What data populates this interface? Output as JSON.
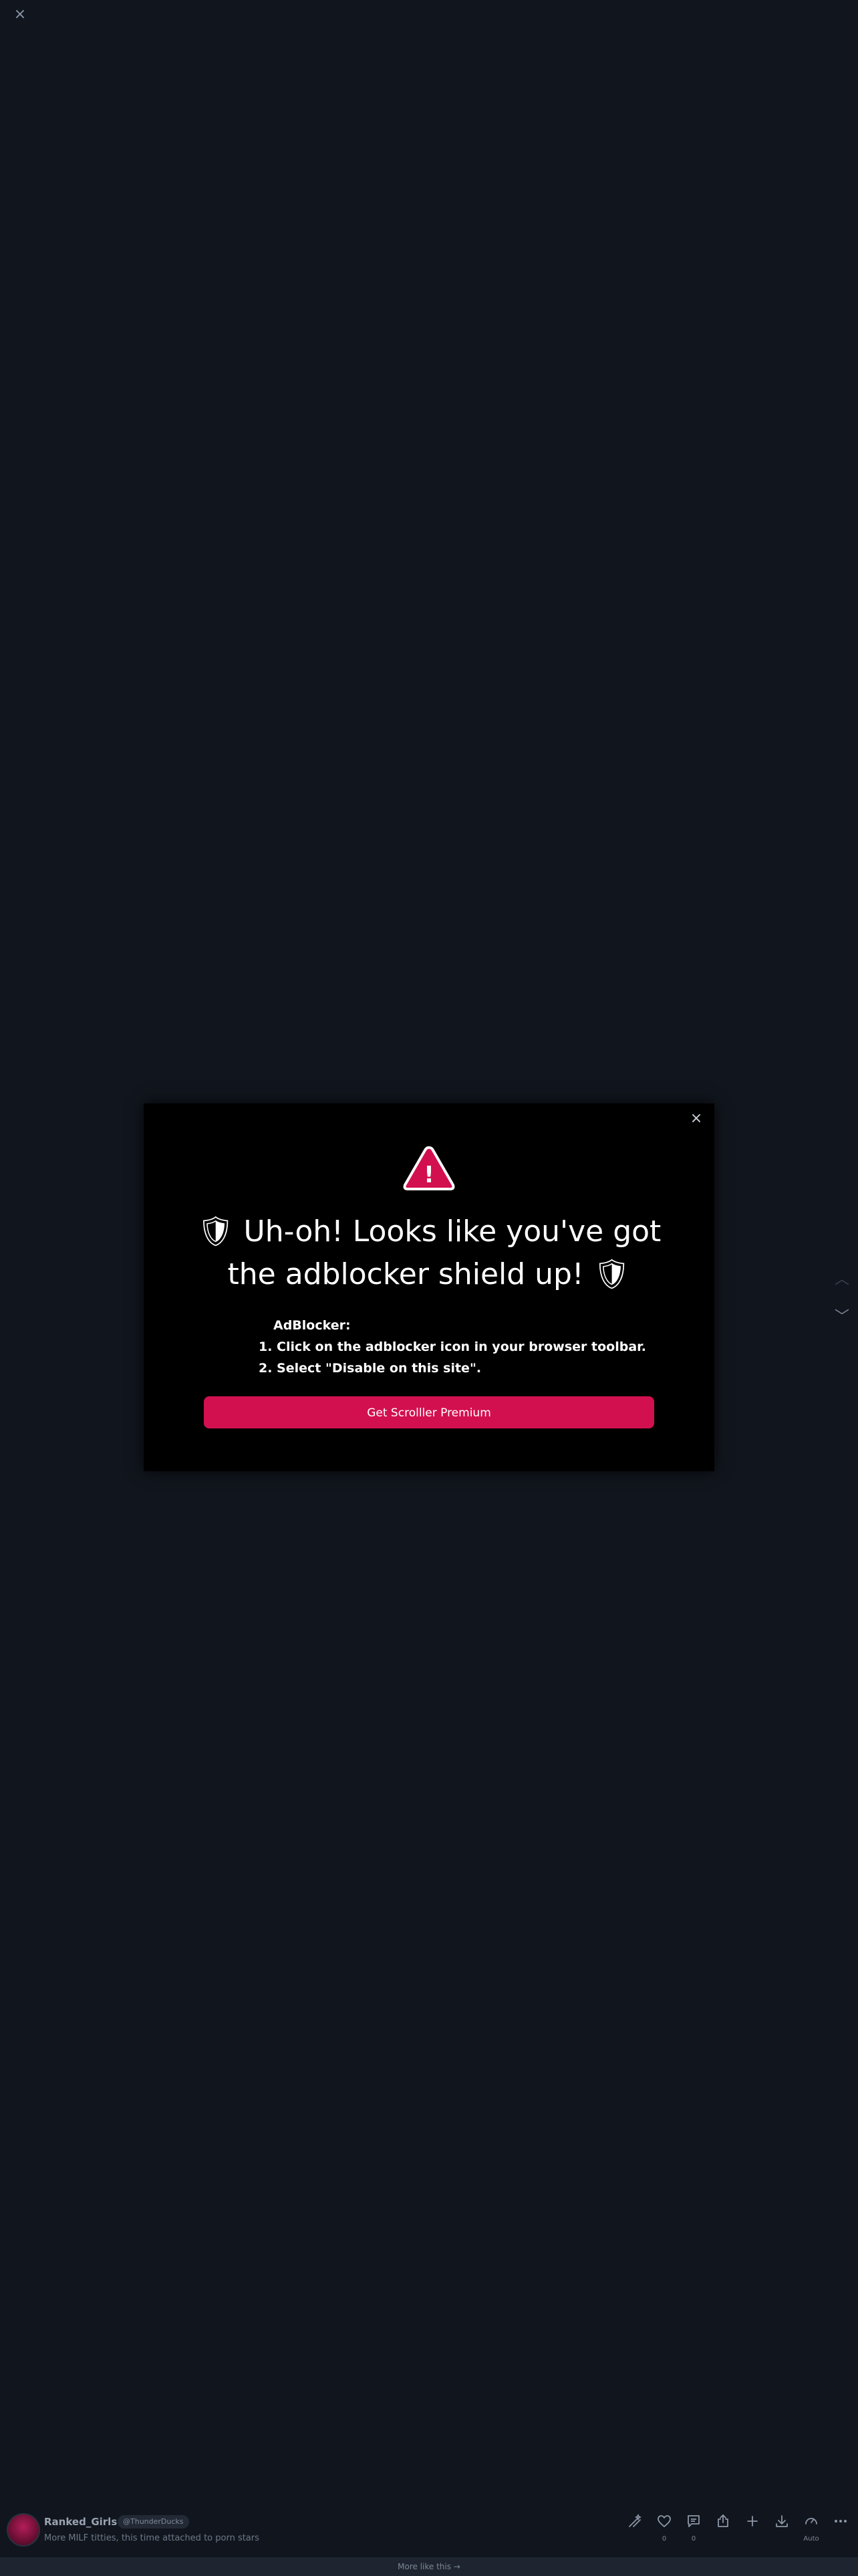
{
  "modal": {
    "close_glyph": "×",
    "warning_glyph": "!",
    "title": "🛡 Uh-oh! Looks like you've got the adblocker shield up! 🛡",
    "instructions_heading": "AdBlocker:",
    "steps": [
      "1. Click on the adblocker icon in your browser toolbar.",
      "2. Select \"Disable on this site\"."
    ],
    "cta_label": "Get Scrolller Premium"
  },
  "viewer": {
    "close_glyph": "×",
    "prev_glyph": "︿",
    "next_glyph": "﹀"
  },
  "post": {
    "author": "Ranked_Girls",
    "handle": "@ThunderDucks",
    "caption": "More MILF titties, this time attached to porn stars"
  },
  "actions": {
    "like_count": "0",
    "comment_count": "0",
    "auto_label": "Auto"
  },
  "footer": {
    "more_label": "More like this →"
  },
  "colors": {
    "background": "#11161e",
    "modal_bg": "#000000",
    "accent": "#d3104f",
    "muted_text": "#8d96a5"
  },
  "icons": [
    "close-icon",
    "warning-icon",
    "magic-wand-icon",
    "heart-icon",
    "comment-icon",
    "share-icon",
    "plus-icon",
    "download-icon",
    "auto-speed-icon",
    "more-icon",
    "chevron-up-icon",
    "chevron-down-icon"
  ]
}
